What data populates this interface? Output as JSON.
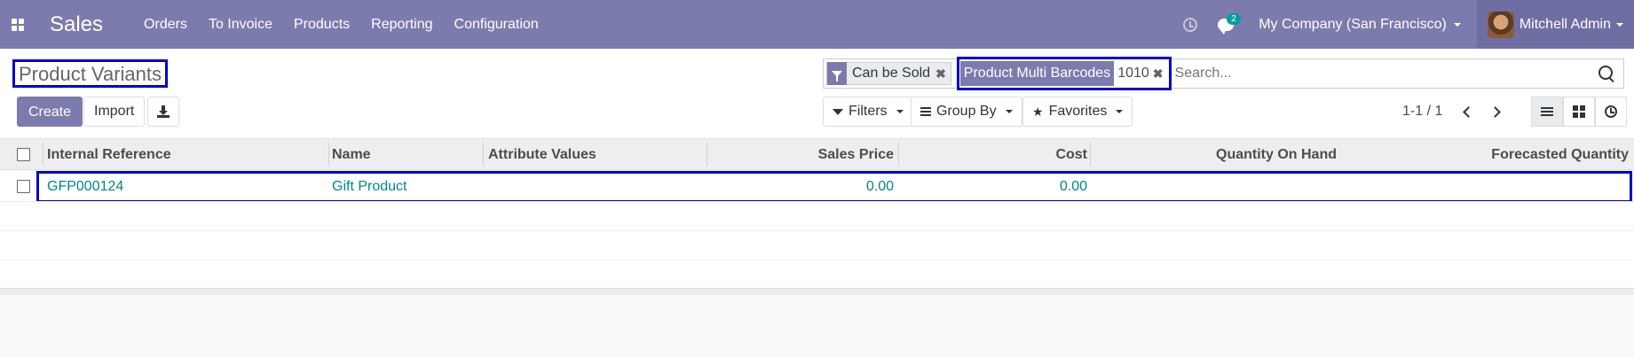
{
  "navbar": {
    "brand": "Sales",
    "menu": [
      "Orders",
      "To Invoice",
      "Products",
      "Reporting",
      "Configuration"
    ],
    "messages_count": "2",
    "company": "My Company (San Francisco)",
    "user": "Mitchell Admin"
  },
  "control": {
    "breadcrumb": "Product Variants",
    "create_label": "Create",
    "import_label": "Import",
    "search": {
      "facets": [
        {
          "label": "Can be Sold"
        },
        {
          "label": "Product Multi Barcodes",
          "value": "1010"
        }
      ],
      "placeholder": "Search..."
    },
    "filters_label": "Filters",
    "groupby_label": "Group By",
    "favorites_label": "Favorites",
    "pager": "1-1 / 1"
  },
  "table": {
    "columns": [
      "Internal Reference",
      "Name",
      "Attribute Values",
      "Sales Price",
      "Cost",
      "Quantity On Hand",
      "Forecasted Quantity"
    ],
    "rows": [
      {
        "internal_reference": "GFP000124",
        "name": "Gift Product",
        "attribute_values": "",
        "sales_price": "0.00",
        "cost": "0.00",
        "qty_on_hand": "",
        "forecasted": ""
      }
    ]
  },
  "colors": {
    "navbar": "#7c7bad",
    "link": "#008784",
    "highlight": "#0000cc"
  }
}
